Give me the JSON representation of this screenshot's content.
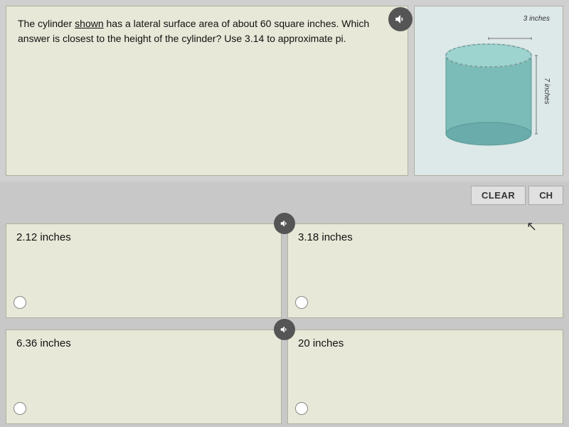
{
  "question": {
    "text_part1": "The cylinder ",
    "text_underline": "shown",
    "text_part2": " has a lateral surface area of about 60 square",
    "text_part3": "inches. Which answer is closest to the height of the cylinder? Use 3.14",
    "text_part4": "to approximate pi.",
    "label_3inches": "3 inches",
    "label_7inches": "7 inches"
  },
  "controls": {
    "clear_label": "CLEAR",
    "check_label": "CH"
  },
  "answers": [
    {
      "id": "a",
      "label": "2.12 inches",
      "selected": false
    },
    {
      "id": "b",
      "label": "3.18 inches",
      "selected": false
    },
    {
      "id": "c",
      "label": "6.36 inches",
      "selected": false
    },
    {
      "id": "d",
      "label": "20 inches",
      "selected": false
    }
  ],
  "icons": {
    "audio": "speaker"
  }
}
